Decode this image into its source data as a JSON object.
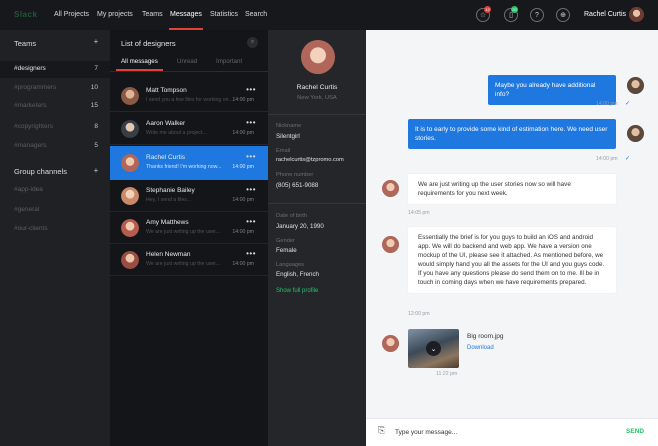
{
  "app": {
    "logo_text": "Slack",
    "accent": "#e3423a",
    "primary": "#1f78e0",
    "success": "#27c269"
  },
  "nav": {
    "items": [
      "All Projects",
      "My projects",
      "Teams",
      "Messages",
      "Statistics",
      "Search"
    ],
    "active": "Messages"
  },
  "header": {
    "user_name": "Rachel Curtis",
    "badges": {
      "star": "12",
      "phone": "20"
    },
    "icons": [
      "star-icon",
      "phone-icon",
      "help-icon",
      "globe-icon"
    ]
  },
  "sidebar": {
    "teams_title": "Teams",
    "teams": [
      {
        "label": "#designers",
        "count": "7"
      },
      {
        "label": "#programmers",
        "count": "10"
      },
      {
        "label": "#marketers",
        "count": "15"
      },
      {
        "label": "#copyrighters",
        "count": "8"
      },
      {
        "label": "#managers",
        "count": "5"
      }
    ],
    "channels_title": "Group channels",
    "channels": [
      "#app-idea",
      "#general",
      "#our-clients"
    ]
  },
  "list": {
    "title": "List of designers",
    "tabs": [
      "All messages",
      "Unread",
      "Important"
    ],
    "people": [
      {
        "name": "Matt Tompson",
        "message": "I send you a few files for working on...",
        "time": "14:00 pm",
        "color": "#8a5a44"
      },
      {
        "name": "Aaron Walker",
        "message": "Write me about a project...",
        "time": "14:00 pm",
        "color": "#3a3d44"
      },
      {
        "name": "Rachel Curtis",
        "message": "Thanks friend! I'm working now...",
        "time": "14:00 pm",
        "color": "#b0675a"
      },
      {
        "name": "Stephanie Bailey",
        "message": "Hey, I send a files...",
        "time": "14:00 pm",
        "color": "#c98a6a"
      },
      {
        "name": "Amy Matthews",
        "message": "We are just writing up the user...",
        "time": "14:00 pm",
        "color": "#b55c4f"
      },
      {
        "name": "Helen Newman",
        "message": "We are just writing up the user...",
        "time": "14:00 pm",
        "color": "#9a4e43"
      }
    ]
  },
  "profile": {
    "name": "Rachel Curtis",
    "location": "New York, USA",
    "fields": [
      {
        "label": "Nickname",
        "value": "Silentgirl"
      },
      {
        "label": "Email",
        "value": "rachelcurtis@tzpromo.com"
      },
      {
        "label": "Phone number",
        "value": "(805) 651-9088"
      },
      {
        "label": "Date of birth",
        "value": "January 20, 1990"
      },
      {
        "label": "Gender",
        "value": "Female"
      },
      {
        "label": "Languages",
        "value": "English, French"
      }
    ],
    "show_full": "Show full profile"
  },
  "chat": {
    "messages": [
      {
        "dir": "out",
        "text": "Maybe you already have additional info?",
        "time": "14:00 pm"
      },
      {
        "dir": "out",
        "text": "It is to early to provide some kind of estimation here. We need user stories.",
        "time": "14:00 pm"
      },
      {
        "dir": "in",
        "text": "We are just writing up the user stories now so will have requirements for you next week.",
        "time": "14:05 pm"
      },
      {
        "dir": "in",
        "text": "Essentially the brief is for you guys to build an iOS and android app. We will do backend and web app. We have a version one mockup of the UI, please see it attached. As mentioned before, we would simply hand you all the assets for the UI and you guys code. If you have any questions please do send them on to me. Ill be in touch in coming days when we have requirements prepared.",
        "time": "12:00 pm"
      }
    ],
    "attachment": {
      "name": "Big room.jpg",
      "action": "Download",
      "time": "11:22 pm"
    },
    "composer": {
      "placeholder": "Type your message...",
      "send": "SEND"
    }
  }
}
